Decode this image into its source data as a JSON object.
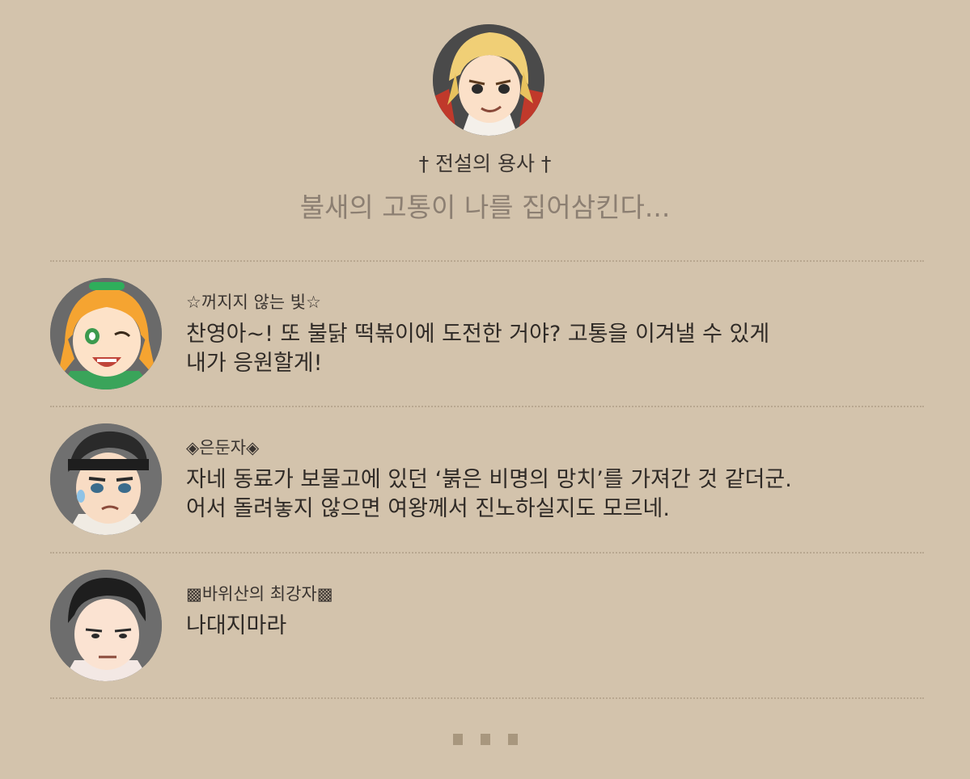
{
  "profile": {
    "name": "† 전설의 용사 †",
    "status": "불새의 고통이 나를 집어삼킨다..."
  },
  "comments": [
    {
      "author": "☆꺼지지 않는 빛☆",
      "text_line1": "찬영아~! 또 불닭 떡볶이에 도전한 거야? 고통을 이겨낼 수 있게",
      "text_line2": "내가 응원할게!"
    },
    {
      "author": "◈은둔자◈",
      "text_line1": "자네 동료가 보물고에 있던 ‘붉은 비명의 망치’를 가져간 것 같더군.",
      "text_line2": "어서 돌려놓지 않으면 여왕께서 진노하실지도 모르네."
    },
    {
      "author": "▩바위산의 최강자▩",
      "text_line1": "나대지마라",
      "text_line2": ""
    }
  ],
  "colors": {
    "background": "#d3c3ac",
    "status_text": "#8c7f72",
    "divider": "#b8a790",
    "more_dots": "#a8977e"
  }
}
